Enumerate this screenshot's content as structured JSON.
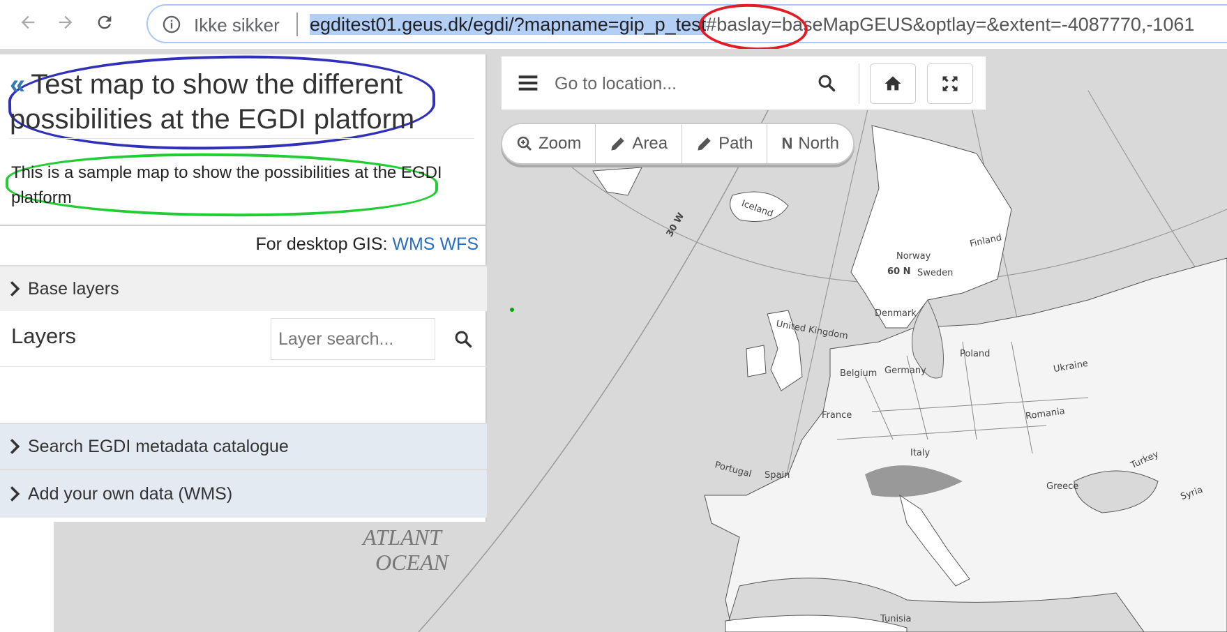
{
  "browser": {
    "back_icon": "arrow-left-icon",
    "forward_icon": "arrow-right-icon",
    "reload_icon": "reload-icon",
    "security_label": "Ikke sikker",
    "url_selected_before": "egditest01.geus.dk/egdi/?mapname=",
    "url_selected_param": "gip_p_test",
    "url_rest": "#baslay=baseMapGEUS&optlay=&extent=-4087770,-1061"
  },
  "panel": {
    "title": "Test map to show the different possibilities at the EGDI platform",
    "description": "This is a sample map to show the possibilities at the EGDI platform",
    "desktop_gis_label": "For desktop GIS:",
    "wms_link": "WMS",
    "wfs_link": "WFS",
    "base_layers_label": "Base layers",
    "layers_title": "Layers",
    "layer_search_placeholder": "Layer search...",
    "metadata_label": "Search EGDI metadata catalogue",
    "add_wms_label": "Add your own data (WMS)"
  },
  "toolbar": {
    "location_placeholder": "Go to location...",
    "zoom_label": "Zoom",
    "area_label": "Area",
    "path_label": "Path",
    "north_label": "North",
    "north_glyph": "N"
  },
  "map": {
    "labels": {
      "iceland": "Iceland",
      "finland": "Finland",
      "norway": "Norway",
      "sweden": "Sweden",
      "meridian": "30 W",
      "parallel": "60 N",
      "denmark": "Denmark",
      "uk": "United Kingdom",
      "poland": "Poland",
      "ukraine": "Ukraine",
      "belgium": "Belgium",
      "germany": "Germany",
      "france": "France",
      "romania": "Romania",
      "italy": "Italy",
      "portugal": "Portugal",
      "spain": "Spain",
      "turkey": "Turkey",
      "greece": "Greece",
      "syria": "Syria",
      "tunisia": "Tunisia"
    },
    "ocean_line1": "ATLANT",
    "ocean_line2": "OCEAN"
  },
  "colors": {
    "annotation_blue": "#3030bb",
    "annotation_green": "#22cc33",
    "annotation_red": "#e21b24",
    "link": "#2a6ebb",
    "url_selection": "#b4cff6"
  }
}
